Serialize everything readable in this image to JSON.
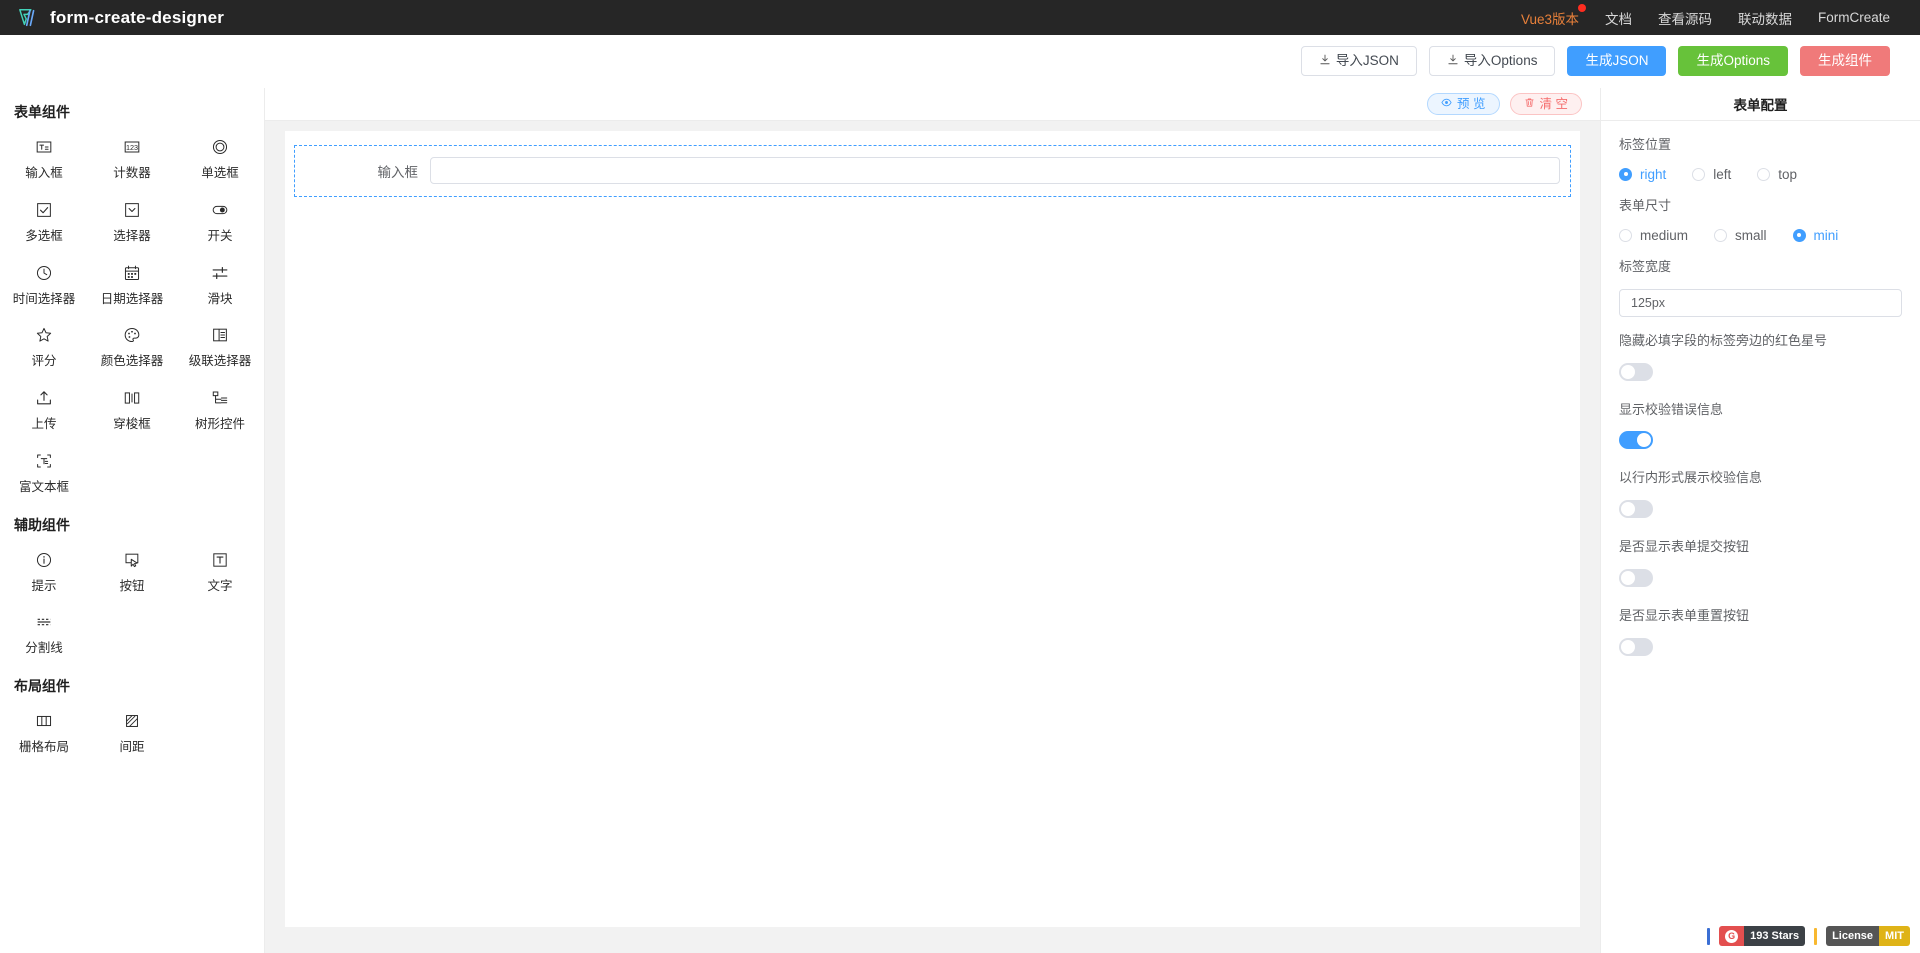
{
  "header": {
    "brand_title": "form-create-designer",
    "nav": [
      {
        "label": "Vue3版本",
        "accent": true,
        "badge_dot": true
      },
      {
        "label": "文档",
        "accent": false,
        "badge_dot": false
      },
      {
        "label": "查看源码",
        "accent": false,
        "badge_dot": false
      },
      {
        "label": "联动数据",
        "accent": false,
        "badge_dot": false
      },
      {
        "label": "FormCreate",
        "accent": false,
        "badge_dot": false
      }
    ]
  },
  "toolbar": {
    "buttons": [
      {
        "label": "导入JSON",
        "style": "default",
        "icon": "import-icon"
      },
      {
        "label": "导入Options",
        "style": "default",
        "icon": "import-icon"
      },
      {
        "label": "生成JSON",
        "style": "primary",
        "icon": ""
      },
      {
        "label": "生成Options",
        "style": "success",
        "icon": ""
      },
      {
        "label": "生成组件",
        "style": "danger",
        "icon": ""
      }
    ]
  },
  "left_panel": {
    "groups": [
      {
        "title": "表单组件",
        "items": [
          {
            "label": "输入框",
            "icon": "input-icon"
          },
          {
            "label": "计数器",
            "icon": "number-icon"
          },
          {
            "label": "单选框",
            "icon": "radio-icon"
          },
          {
            "label": "多选框",
            "icon": "checkbox-icon"
          },
          {
            "label": "选择器",
            "icon": "select-icon"
          },
          {
            "label": "开关",
            "icon": "switch-icon"
          },
          {
            "label": "时间选择器",
            "icon": "clock-icon"
          },
          {
            "label": "日期选择器",
            "icon": "calendar-icon"
          },
          {
            "label": "滑块",
            "icon": "slider-icon"
          },
          {
            "label": "评分",
            "icon": "star-icon"
          },
          {
            "label": "颜色选择器",
            "icon": "palette-icon"
          },
          {
            "label": "级联选择器",
            "icon": "cascader-icon"
          },
          {
            "label": "上传",
            "icon": "upload-icon"
          },
          {
            "label": "穿梭框",
            "icon": "transfer-icon"
          },
          {
            "label": "树形控件",
            "icon": "tree-icon"
          },
          {
            "label": "富文本框",
            "icon": "richtext-icon"
          }
        ]
      },
      {
        "title": "辅助组件",
        "items": [
          {
            "label": "提示",
            "icon": "info-icon"
          },
          {
            "label": "按钮",
            "icon": "button-icon"
          },
          {
            "label": "文字",
            "icon": "text-icon"
          },
          {
            "label": "分割线",
            "icon": "divider-icon"
          }
        ]
      },
      {
        "title": "布局组件",
        "items": [
          {
            "label": "栅格布局",
            "icon": "grid-icon"
          },
          {
            "label": "间距",
            "icon": "space-icon"
          }
        ]
      }
    ]
  },
  "center": {
    "preview_label": "预 览",
    "clear_label": "清 空",
    "form_rows": [
      {
        "label": "输入框",
        "value": "",
        "placeholder": ""
      }
    ]
  },
  "right_panel": {
    "title": "表单配置",
    "fields": [
      {
        "label": "标签位置",
        "type": "radio",
        "options": [
          {
            "label": "right",
            "selected": true
          },
          {
            "label": "left",
            "selected": false
          },
          {
            "label": "top",
            "selected": false
          }
        ]
      },
      {
        "label": "表单尺寸",
        "type": "radio",
        "options": [
          {
            "label": "medium",
            "selected": false
          },
          {
            "label": "small",
            "selected": false
          },
          {
            "label": "mini",
            "selected": true
          }
        ]
      },
      {
        "label": "标签宽度",
        "type": "text",
        "value": "125px",
        "placeholder": ""
      },
      {
        "label": "隐藏必填字段的标签旁边的红色星号",
        "type": "switch",
        "on": false
      },
      {
        "label": "显示校验错误信息",
        "type": "switch",
        "on": true
      },
      {
        "label": "以行内形式展示校验信息",
        "type": "switch",
        "on": false
      },
      {
        "label": "是否显示表单提交按钮",
        "type": "switch",
        "on": false
      },
      {
        "label": "是否显示表单重置按钮",
        "type": "switch",
        "on": false
      }
    ]
  },
  "footer": {
    "badges": [
      {
        "kind": "gitee",
        "left": "193 Stars",
        "right": "",
        "mark": "G"
      },
      {
        "kind": "license",
        "left": "License",
        "right": "MIT",
        "mark": ""
      }
    ]
  },
  "colors": {
    "header_bg": "#262626",
    "accent": "#e8803a",
    "primary": "#409eff",
    "success": "#67c23a",
    "danger": "#f07a7a",
    "canvas_bg": "#f2f2f2"
  }
}
